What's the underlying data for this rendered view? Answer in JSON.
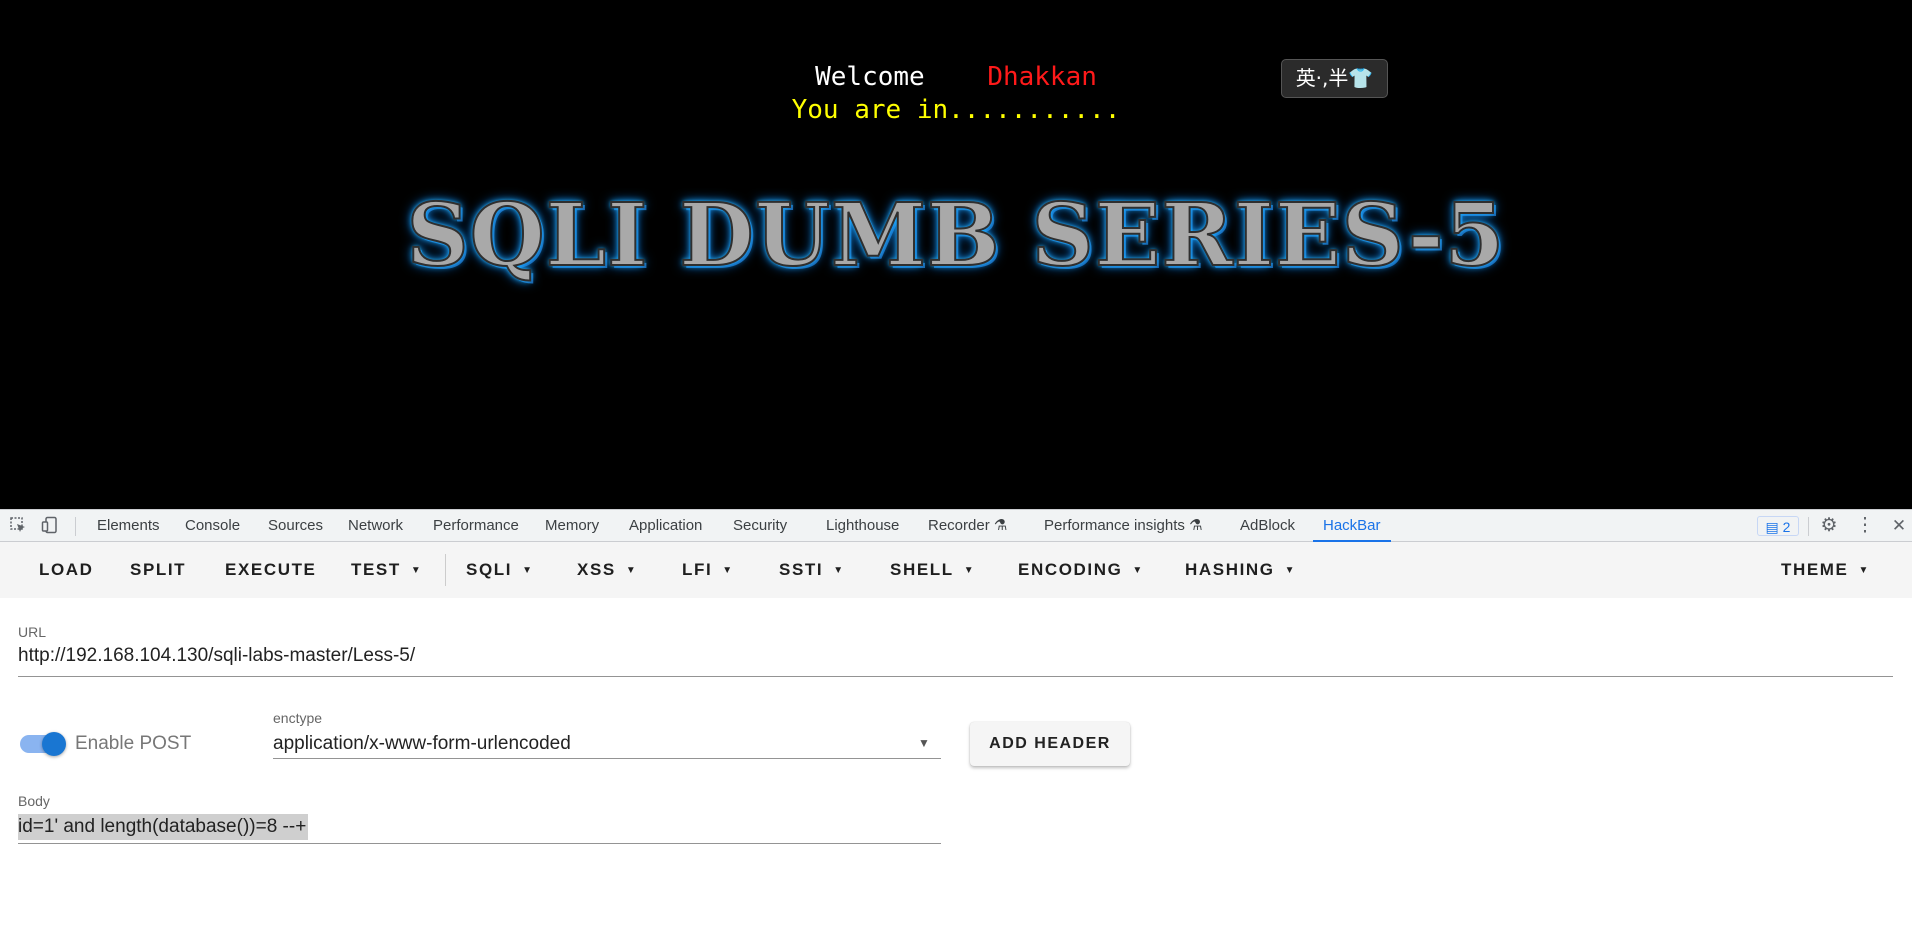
{
  "page": {
    "welcome_word": "Welcome",
    "user_name": "Dhakkan",
    "status_line": "You are in...........",
    "banner_title": "SQLI DUMB SERIES-5",
    "ime_indicator": "英·,半👕"
  },
  "devtools": {
    "tabs": [
      "Elements",
      "Console",
      "Sources",
      "Network",
      "Performance",
      "Memory",
      "Application",
      "Security",
      "Lighthouse",
      "Recorder ⚗",
      "Performance insights ⚗",
      "AdBlock",
      "HackBar"
    ],
    "active_tab": "HackBar",
    "issues_count": "2"
  },
  "hackbar": {
    "toolbar": [
      "LOAD",
      "SPLIT",
      "EXECUTE",
      "TEST",
      "SQLI",
      "XSS",
      "LFI",
      "SSTI",
      "SHELL",
      "ENCODING",
      "HASHING",
      "THEME"
    ],
    "url_label": "URL",
    "url_value": "http://192.168.104.130/sqli-labs-master/Less-5/",
    "enable_post_label": "Enable POST",
    "enable_post_on": true,
    "enctype_label": "enctype",
    "enctype_value": "application/x-www-form-urlencoded",
    "add_header_label": "ADD HEADER",
    "body_label": "Body",
    "body_value": "id=1' and length(database())=8 --+"
  },
  "colors": {
    "accent": "#1a73e8",
    "welcome": "#ffffff",
    "user_name": "#ff1a1a",
    "status_line": "#ffff00",
    "banner_glow": "#27b6ff"
  }
}
